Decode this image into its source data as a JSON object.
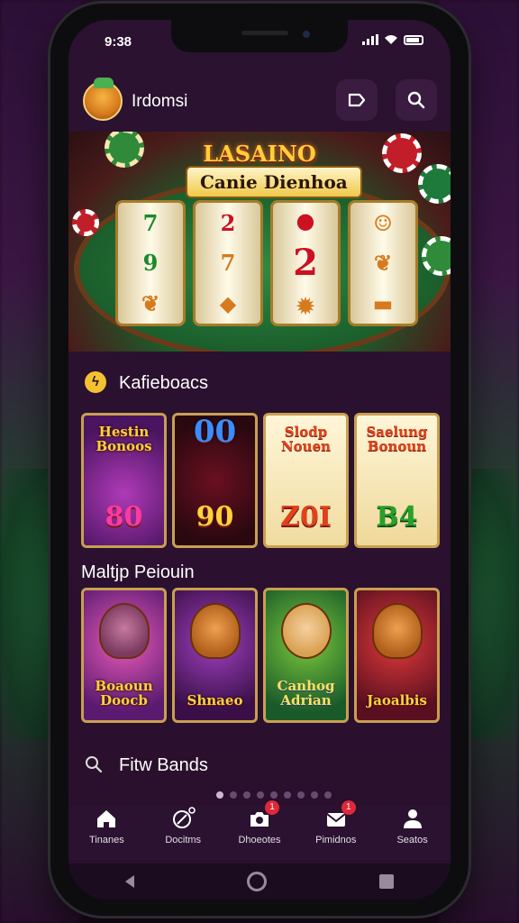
{
  "status": {
    "time": "9:38"
  },
  "header": {
    "app_name": "Irdomsi"
  },
  "banner": {
    "title": "LASAINO",
    "subtitle": "Canie Dienhoa"
  },
  "sections": {
    "featured": {
      "heading": "Kafieboacs",
      "cards": [
        {
          "title": "Hestin Bonoos",
          "value": "80"
        },
        {
          "title": "00",
          "value": "90"
        },
        {
          "title": "Slodp Nouen",
          "value": "Z0I"
        },
        {
          "title": "Saelung Bonoun",
          "value": "B4"
        }
      ]
    },
    "multiplayer": {
      "heading": "Maltjp Peiouin",
      "cards": [
        {
          "title": "Boaoun Doocb"
        },
        {
          "title": "Shnaeo"
        },
        {
          "title": "Canhog Adrian"
        },
        {
          "title": "Jaoalbis"
        }
      ]
    },
    "find": {
      "heading": "Fitw Bands"
    }
  },
  "nav": {
    "items": [
      {
        "label": "Tinanes",
        "icon": "home-icon",
        "badge": ""
      },
      {
        "label": "Docitms",
        "icon": "ball-icon",
        "badge": ""
      },
      {
        "label": "Dhoeotes",
        "icon": "camera-icon",
        "badge": "1"
      },
      {
        "label": "Pimidnos",
        "icon": "mail-icon",
        "badge": "1"
      },
      {
        "label": "Seatos",
        "icon": "profile-icon",
        "badge": ""
      }
    ]
  },
  "colors": {
    "accent": "#f3c230",
    "background": "#2a1230",
    "badge": "#e0283a"
  }
}
